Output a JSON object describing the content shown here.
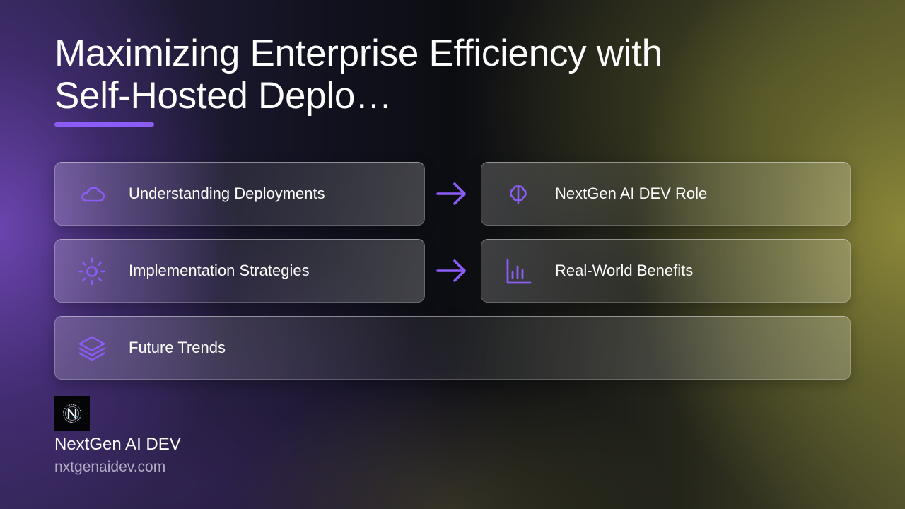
{
  "slide": {
    "title_line1": "Maximizing Enterprise Efficiency with",
    "title_line2": "Self-Hosted Deplo…"
  },
  "accent_color": "#8b5cf6",
  "cards": [
    {
      "label": "Understanding Deployments",
      "icon": "cloud-icon"
    },
    {
      "label": "NextGen AI DEV Role",
      "icon": "brain-icon"
    },
    {
      "label": "Implementation Strategies",
      "icon": "sun-gear-icon"
    },
    {
      "label": "Real-World Benefits",
      "icon": "bar-chart-icon"
    },
    {
      "label": "Future Trends",
      "icon": "layers-icon"
    }
  ],
  "arrows": [
    "arrow-right-icon",
    "arrow-right-icon"
  ],
  "brand": {
    "name": "NextGen AI DEV",
    "url": "nxtgenaidev.com",
    "logo_icon": "nextgen-logo-icon"
  }
}
